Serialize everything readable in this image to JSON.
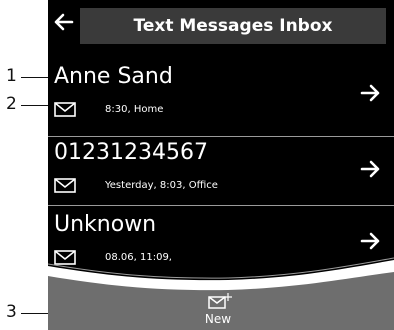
{
  "header": {
    "title": "Text Messages Inbox",
    "back_icon": "back-arrow-icon"
  },
  "messages": [
    {
      "sender": "Anne Sand",
      "info": "8:30, Home",
      "status_icon": "envelope-icon",
      "open_icon": "arrow-right-icon"
    },
    {
      "sender": "01231234567",
      "info": "Yesterday, 8:03, Office",
      "status_icon": "envelope-icon",
      "open_icon": "arrow-right-icon"
    },
    {
      "sender": "Unknown",
      "info": "08.06, 11:09,",
      "status_icon": "envelope-icon",
      "open_icon": "arrow-right-icon"
    }
  ],
  "footer": {
    "new_label": "New",
    "new_icon": "new-message-icon"
  },
  "callouts": [
    "1",
    "2",
    "3"
  ],
  "colors": {
    "screen_bg": "#000000",
    "title_bg": "#3a3a3a",
    "footer_bg": "#6e6e6e",
    "text": "#ffffff"
  }
}
